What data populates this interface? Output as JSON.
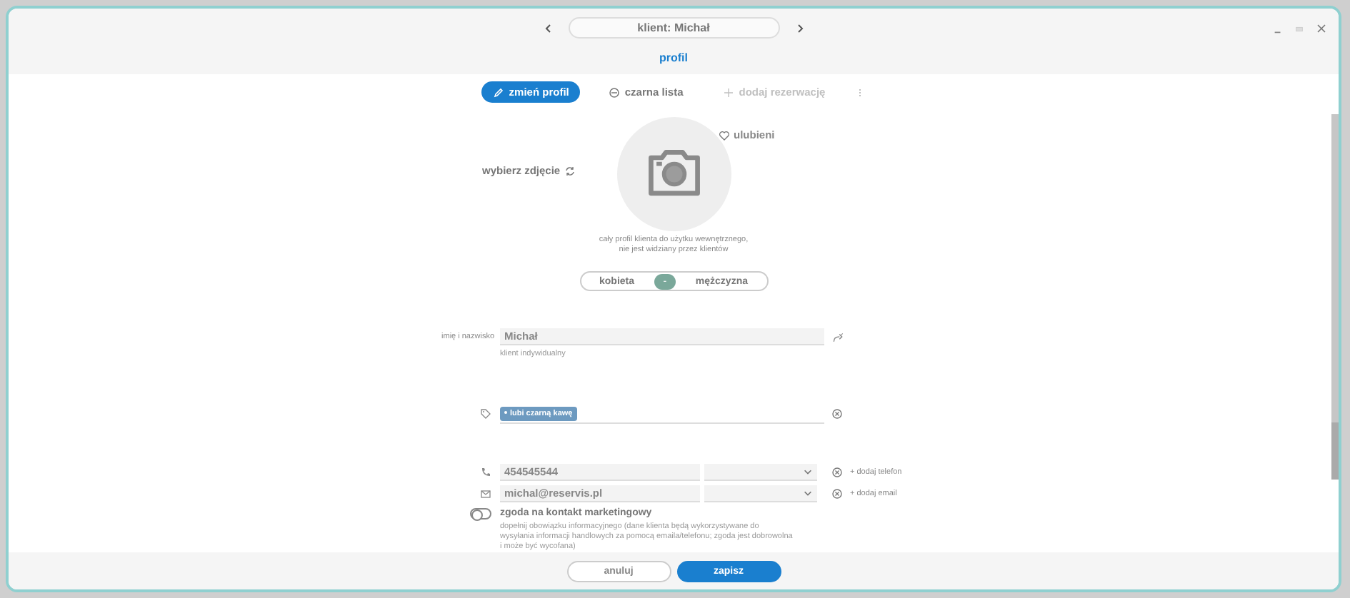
{
  "window": {
    "title": "klient: Michał"
  },
  "tabs": [
    {
      "label": "profil",
      "selected": true
    }
  ],
  "actions": [
    {
      "label": "zmień profil",
      "kind": "primary"
    },
    {
      "label": "czarna lista",
      "kind": "blacklist"
    },
    {
      "label": "dodaj rezerwację",
      "kind": "disabled"
    }
  ],
  "photo": {
    "choose_label": "wybierz zdjęcie",
    "favorite_label": "ulubieni",
    "favorite": false,
    "note": "cały profil klienta do użytku wewnętrznego,\nnie jest widziany przez klientów"
  },
  "gender": {
    "options": [
      {
        "label": "kobieta",
        "selected": false
      },
      {
        "label": "mężczyzna",
        "selected": false
      }
    ],
    "neutral_mark": "-"
  },
  "name": {
    "label": "imię i nazwisko",
    "value": "Michał",
    "hint": "klient indywidualny"
  },
  "tags": [
    {
      "label": "lubi czarną kawę"
    }
  ],
  "phones": [
    {
      "value": "454545544",
      "add_label": "+ dodaj telefon"
    }
  ],
  "emails": [
    {
      "value": "michal@reservis.pl",
      "add_label": "+ dodaj email"
    }
  ],
  "marketing": {
    "label": "zgoda na kontakt marketingowy",
    "on": false,
    "description": "dopełnij obowiązku informacyjnego (dane klienta będą wykorzystywane do wysyłania informacji handlowych za pomocą emaila/telefonu; zgoda jest dobrowolna i może być wycofana)"
  },
  "buttons": [
    {
      "label": "anuluj",
      "kind": "secondary"
    },
    {
      "label": "zapisz",
      "kind": "primary"
    }
  ]
}
